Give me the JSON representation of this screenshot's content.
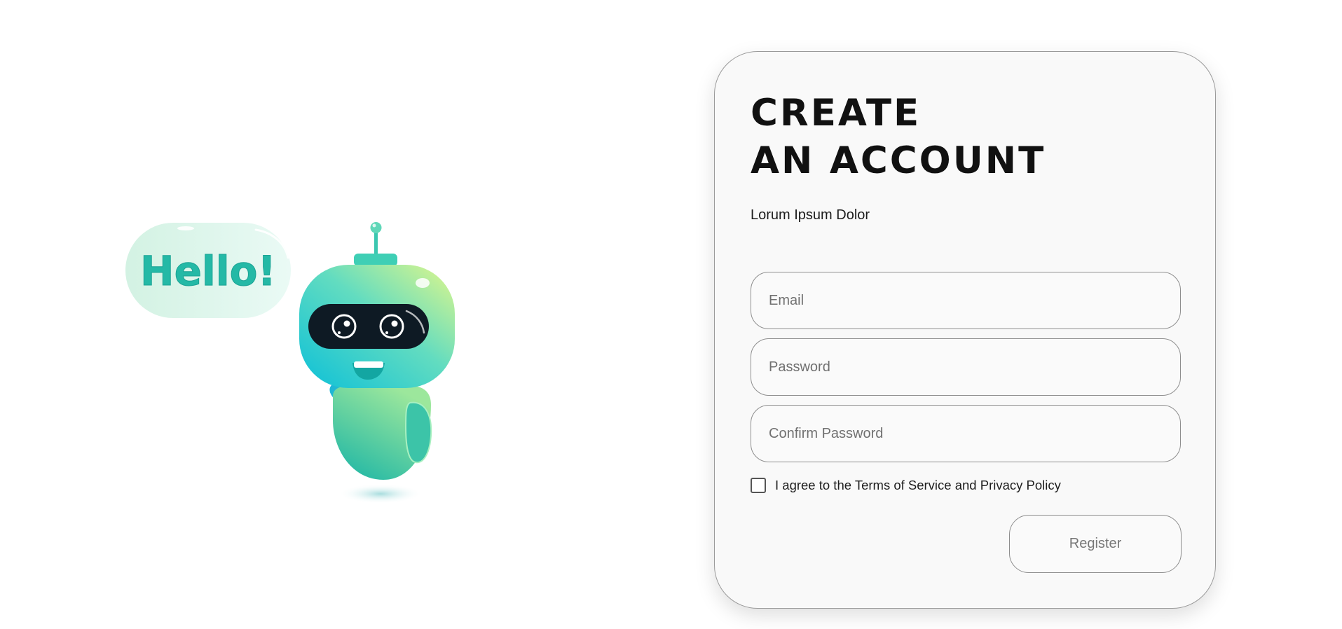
{
  "illustration": {
    "speech_bubble_text": "Hello!",
    "colors": {
      "body_teal": "#16bfd0",
      "body_green": "#8ee89e",
      "highlight_yellow": "#e2f78a",
      "visor": "#0e1a24",
      "bubble": "#dcf5e9",
      "hello_text": "#24b9a6"
    }
  },
  "form": {
    "title_line1": "CREATE",
    "title_line2": "AN ACCOUNT",
    "subtitle": "Lorum Ipsum Dolor",
    "email_placeholder": "Email",
    "password_placeholder": "Password",
    "confirm_password_placeholder": "Confirm Password",
    "terms_label": "I agree to the Terms of Service and Privacy Policy",
    "terms_checked": false,
    "register_label": "Register"
  }
}
